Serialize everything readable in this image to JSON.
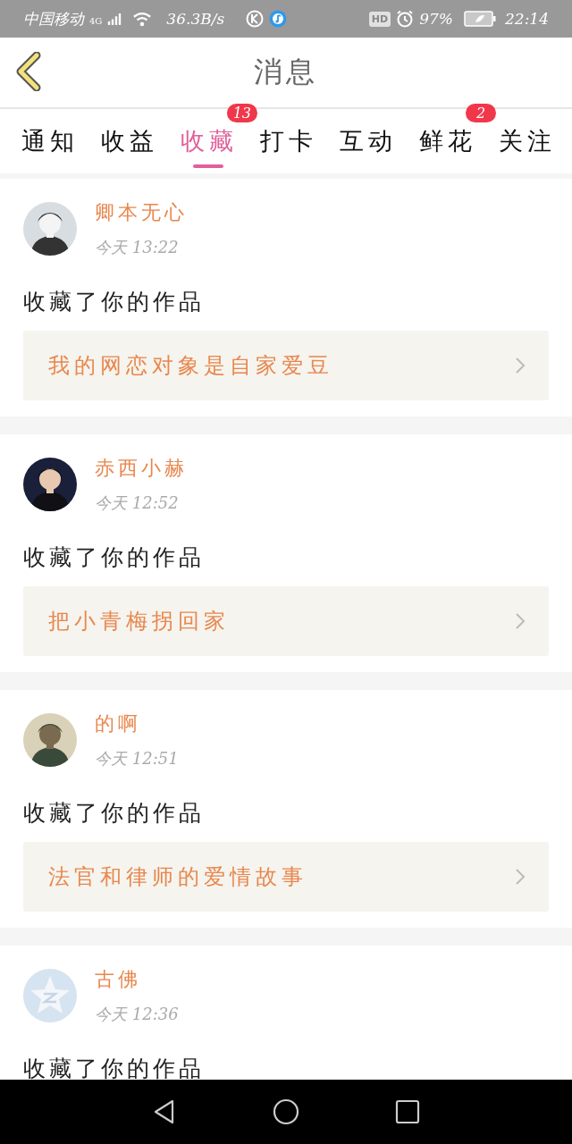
{
  "status_bar": {
    "carrier": "中国移动",
    "network": "4G",
    "speed": "36.3B/s",
    "hd": "HD",
    "battery": "97%",
    "time": "22:14"
  },
  "header": {
    "title": "消息"
  },
  "tabs": [
    {
      "label": "通知",
      "selected": false
    },
    {
      "label": "收益",
      "selected": false
    },
    {
      "label": "收藏",
      "selected": true,
      "badge": "13"
    },
    {
      "label": "打卡",
      "selected": false
    },
    {
      "label": "互动",
      "selected": false
    },
    {
      "label": "鲜花",
      "selected": false,
      "badge": "2"
    },
    {
      "label": "关注",
      "selected": false
    }
  ],
  "messages": [
    {
      "name": "卿本无心",
      "time": "今天 13:22",
      "action": "收藏了你的作品",
      "work": "我的网恋对象是自家爱豆"
    },
    {
      "name": "赤西小赫",
      "time": "今天 12:52",
      "action": "收藏了你的作品",
      "work": "把小青梅拐回家"
    },
    {
      "name": "的啊",
      "time": "今天 12:51",
      "action": "收藏了你的作品",
      "work": "法官和律师的爱情故事"
    },
    {
      "avatar": {
        "kind": "icon"
      },
      "name": "古佛",
      "time": "今天 12:36",
      "action": "收藏了你的作品"
    }
  ]
}
